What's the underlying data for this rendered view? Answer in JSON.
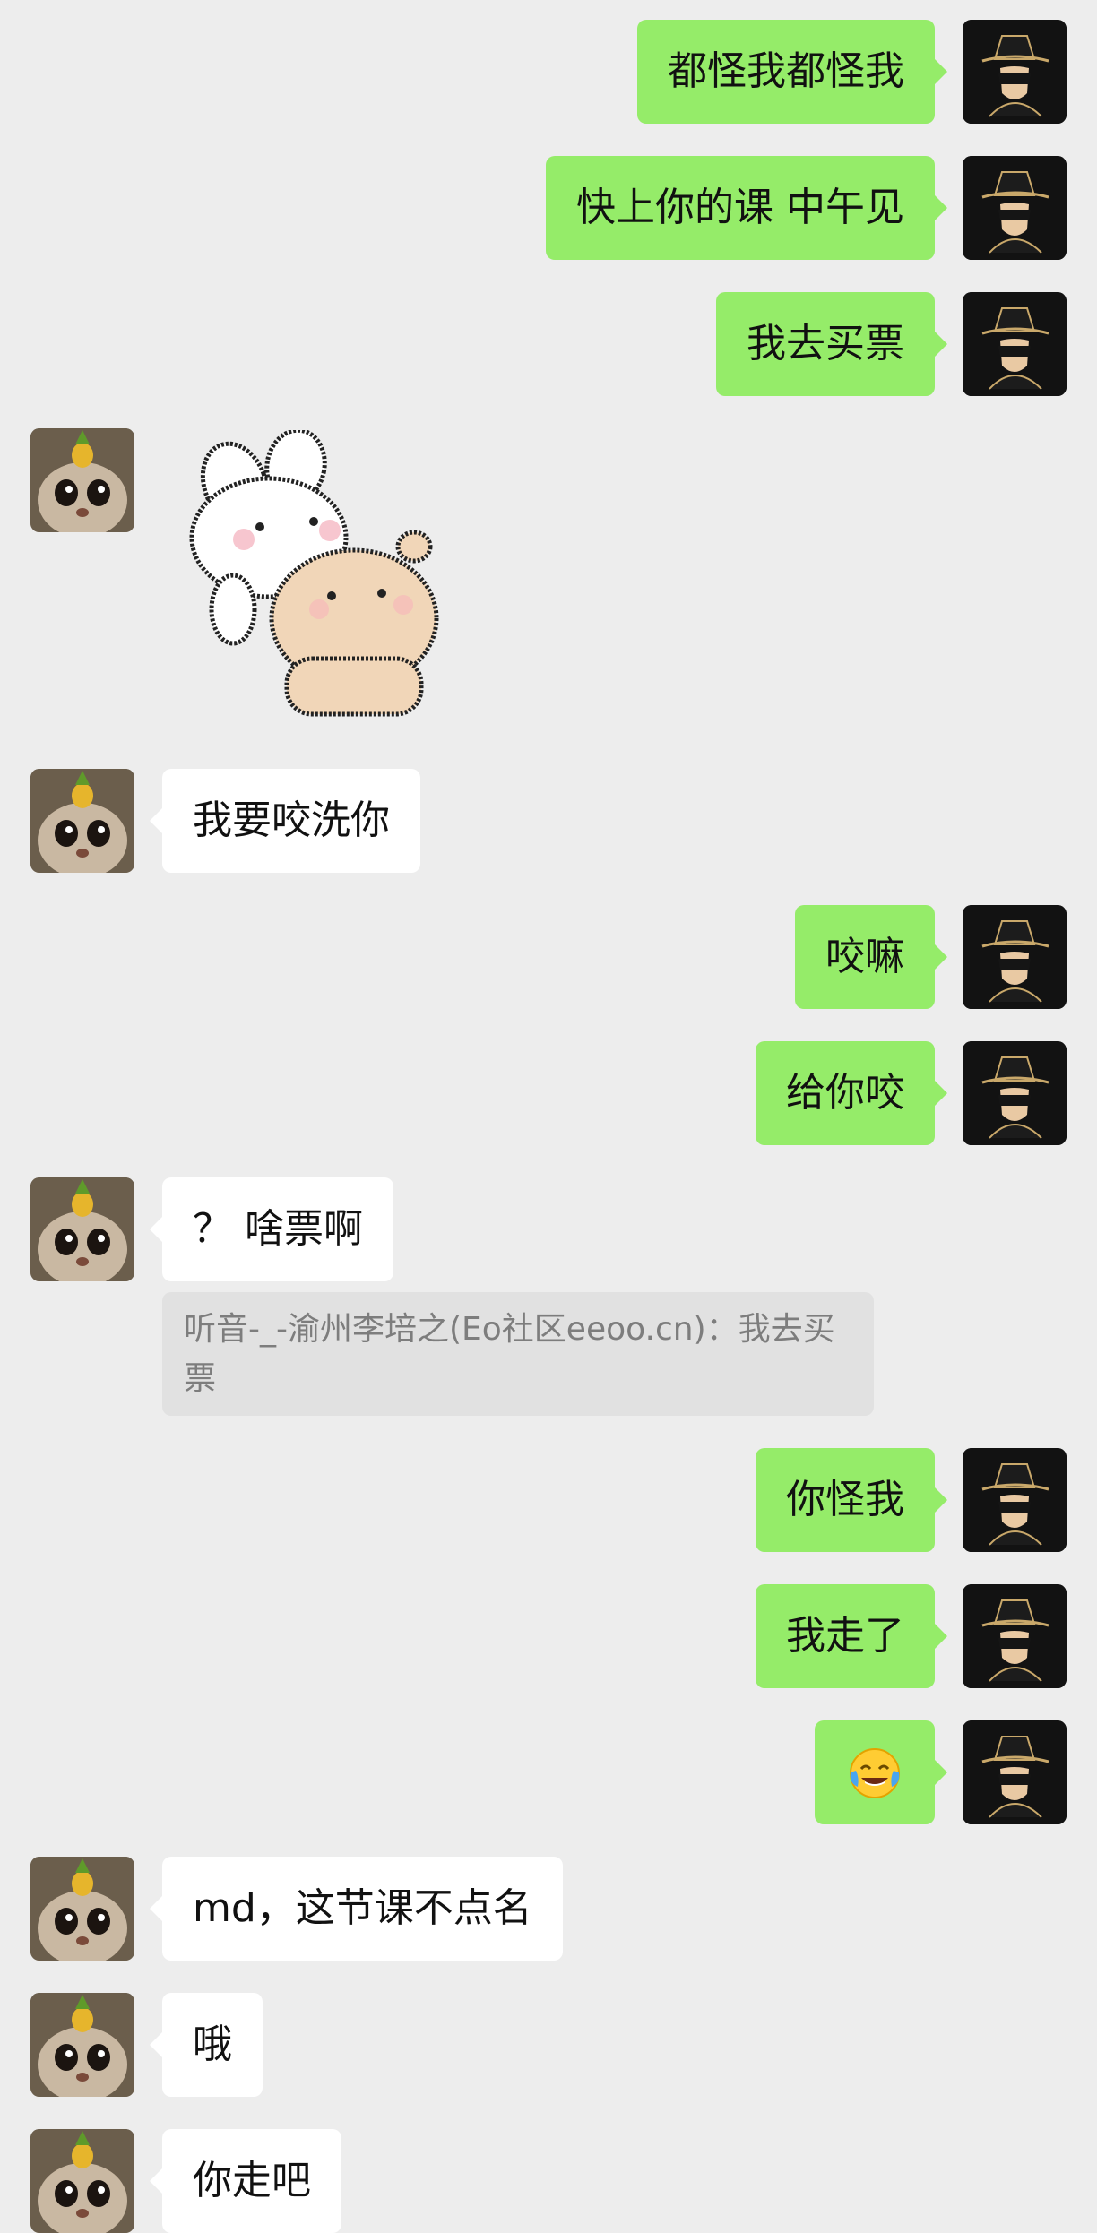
{
  "conversation": {
    "messages": [
      {
        "sender": "me",
        "type": "text",
        "text": "都怪我都怪我"
      },
      {
        "sender": "me",
        "type": "text",
        "text": "快上你的课 中午见"
      },
      {
        "sender": "me",
        "type": "text",
        "text": "我去买票"
      },
      {
        "sender": "contact",
        "type": "sticker",
        "sticker": "white-rabbit-hugging-bear"
      },
      {
        "sender": "contact",
        "type": "text",
        "text": "我要咬洗你"
      },
      {
        "sender": "me",
        "type": "text",
        "text": "咬嘛"
      },
      {
        "sender": "me",
        "type": "text",
        "text": "给你咬"
      },
      {
        "sender": "contact",
        "type": "text",
        "text": "？ 啥票啊"
      },
      {
        "sender": "me",
        "type": "text",
        "text": "你怪我"
      },
      {
        "sender": "me",
        "type": "text",
        "text": "我走了"
      },
      {
        "sender": "me",
        "type": "emoji",
        "emoji": "face-with-tears-of-joy"
      },
      {
        "sender": "contact",
        "type": "text",
        "text": "md，这节课不点名"
      },
      {
        "sender": "contact",
        "type": "text",
        "text": "哦"
      },
      {
        "sender": "contact",
        "type": "text",
        "text": "你走吧"
      }
    ],
    "quote": {
      "text": "听音-_-渝州李培之(Eo社区eeoo.cn)：我去买票"
    }
  },
  "avatars": {
    "me": "hat-silhouette-icon",
    "contact": "cat-with-pineapple-icon"
  },
  "colors": {
    "background": "#ededed",
    "sent_bubble": "#95ec69",
    "received_bubble": "#ffffff",
    "quote_background": "#e1e1e1",
    "quote_text": "#7d7d7d"
  }
}
